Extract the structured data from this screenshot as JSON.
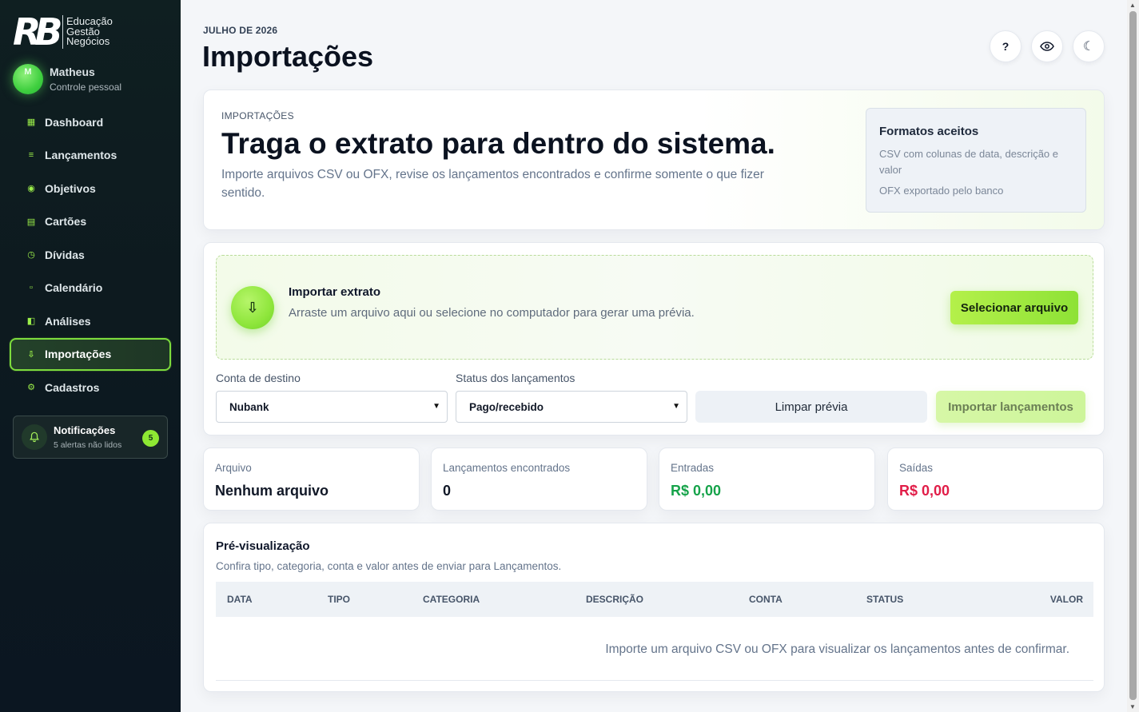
{
  "brand": {
    "mark": "RB",
    "line1": "Educação",
    "line2": "Gestão",
    "line3": "Negócios"
  },
  "user": {
    "initial": "M",
    "name": "Matheus",
    "subtitle": "Controle pessoal"
  },
  "nav": [
    {
      "label": "Dashboard",
      "icon": "dashboard-icon",
      "glyph": "▦"
    },
    {
      "label": "Lançamentos",
      "icon": "list-icon",
      "glyph": "≡"
    },
    {
      "label": "Objetivos",
      "icon": "target-icon",
      "glyph": "◉"
    },
    {
      "label": "Cartões",
      "icon": "card-icon",
      "glyph": "▤"
    },
    {
      "label": "Dívidas",
      "icon": "clock-icon",
      "glyph": "◷"
    },
    {
      "label": "Calendário",
      "icon": "calendar-icon",
      "glyph": "▫"
    },
    {
      "label": "Análises",
      "icon": "chart-icon",
      "glyph": "◧"
    },
    {
      "label": "Importações",
      "icon": "download-icon",
      "glyph": "⇩",
      "active": true
    },
    {
      "label": "Cadastros",
      "icon": "gear-icon",
      "glyph": "⚙"
    }
  ],
  "notifications": {
    "title": "Notificações",
    "subtitle": "5 alertas não lidos",
    "count": "5"
  },
  "header": {
    "month": "JULHO DE 2026",
    "title": "Importações"
  },
  "top_actions": {
    "help": "?",
    "visibility": "👁",
    "theme": "☾"
  },
  "hero": {
    "eyebrow": "IMPORTAÇÕES",
    "title": "Traga o extrato para dentro do sistema.",
    "description": "Importe arquivos CSV ou OFX, revise os lançamentos encontrados e confirme somente o que fizer sentido.",
    "formats_title": "Formatos aceitos",
    "formats": [
      "CSV com colunas de data, descrição e valor",
      "OFX exportado pelo banco"
    ]
  },
  "import": {
    "drop_title": "Importar extrato",
    "drop_subtitle": "Arraste um arquivo aqui ou selecione no computador para gerar uma prévia.",
    "select_file": "Selecionar arquivo",
    "account_label": "Conta de destino",
    "account_value": "Nubank",
    "status_label": "Status dos lançamentos",
    "status_value": "Pago/recebido",
    "clear_button": "Limpar prévia",
    "import_button": "Importar lançamentos"
  },
  "stats": [
    {
      "label": "Arquivo",
      "value": "Nenhum arquivo",
      "color": "#111827"
    },
    {
      "label": "Lançamentos encontrados",
      "value": "0",
      "color": "#111827"
    },
    {
      "label": "Entradas",
      "value": "R$ 0,00",
      "color": "#16a34a"
    },
    {
      "label": "Saídas",
      "value": "R$ 0,00",
      "color": "#e11d48"
    }
  ],
  "preview": {
    "title": "Pré-visualização",
    "subtitle": "Confira tipo, categoria, conta e valor antes de enviar para Lançamentos.",
    "columns": [
      "DATA",
      "TIPO",
      "CATEGORIA",
      "DESCRIÇÃO",
      "CONTA",
      "STATUS",
      "VALOR"
    ],
    "empty_message": "Importe um arquivo CSV ou OFX para visualizar os lançamentos antes de confirmar."
  },
  "colors": {
    "accent": "#8ee236",
    "sidebar": "#0f1f21",
    "income": "#16a34a",
    "expense": "#e11d48"
  }
}
